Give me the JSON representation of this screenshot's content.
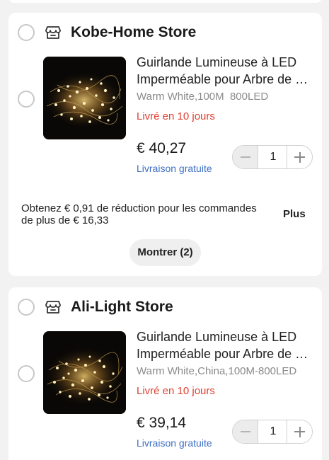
{
  "colors": {
    "background": "#f2f2f2",
    "card": "#ffffff",
    "delivery": "#e0402f",
    "shipping_link": "#3d6fc4",
    "muted_text": "#8a8a8a"
  },
  "stores": [
    {
      "name": "Kobe-Home Store",
      "store_icon": "store-icon",
      "item": {
        "title_line1": "Guirlande Lumineuse à LED",
        "title_line2": "Imperméable pour Arbre de Noël",
        "variant": "Warm White,100M  800LED",
        "delivery": "Livré en 10 jours",
        "price": "€ 40,27",
        "shipping": "Livraison gratuite",
        "quantity": "1"
      },
      "promo": {
        "text": "Obtenez € 0,91 de réduction pour les commandes de plus de € 16,33",
        "more_label": "Plus"
      },
      "show_more_label": "Montrer (2)"
    },
    {
      "name": "Ali-Light Store",
      "store_icon": "store-icon",
      "item": {
        "title_line1": "Guirlande Lumineuse à LED",
        "title_line2": "Imperméable pour Arbre de Noël",
        "variant": "Warm White,China,100M-800LED",
        "delivery": "Livré en 10 jours",
        "price": "€ 39,14",
        "shipping": "Livraison gratuite",
        "quantity": "1"
      }
    }
  ]
}
